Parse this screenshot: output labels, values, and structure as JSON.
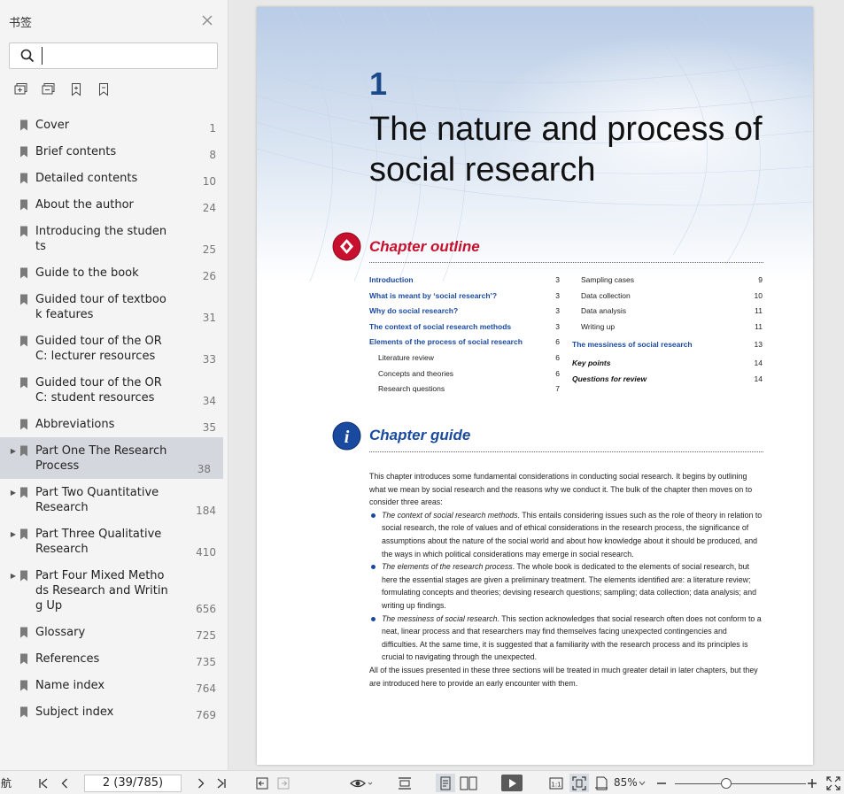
{
  "sidebar": {
    "title": "书签",
    "search_value": "",
    "bookmarks": [
      {
        "label": "Cover",
        "page": "1",
        "expandable": false
      },
      {
        "label": "Brief contents",
        "page": "8",
        "expandable": false
      },
      {
        "label": "Detailed contents",
        "page": "10",
        "expandable": false
      },
      {
        "label": "About the author",
        "page": "24",
        "expandable": false
      },
      {
        "label": "Introducing the students",
        "page": "25",
        "expandable": false
      },
      {
        "label": "Guide to the book",
        "page": "26",
        "expandable": false
      },
      {
        "label": "Guided tour of textbook features",
        "page": "31",
        "expandable": false
      },
      {
        "label": "Guided tour of the ORC: lecturer resources",
        "page": "33",
        "expandable": false
      },
      {
        "label": "Guided tour of the ORC: student resources",
        "page": "34",
        "expandable": false
      },
      {
        "label": "Abbreviations",
        "page": "35",
        "expandable": false
      },
      {
        "label": "Part One The Research Process",
        "page": "38",
        "expandable": true,
        "selected": true
      },
      {
        "label": "Part Two Quantitative Research",
        "page": "184",
        "expandable": true
      },
      {
        "label": "Part Three Qualitative Research",
        "page": "410",
        "expandable": true
      },
      {
        "label": "Part Four Mixed Methods Research and Writing Up",
        "page": "656",
        "expandable": true
      },
      {
        "label": "Glossary",
        "page": "725",
        "expandable": false
      },
      {
        "label": "References",
        "page": "735",
        "expandable": false
      },
      {
        "label": "Name index",
        "page": "764",
        "expandable": false
      },
      {
        "label": "Subject index",
        "page": "769",
        "expandable": false
      }
    ]
  },
  "document": {
    "chapter_number": "1",
    "chapter_title": "The nature and process of social research",
    "outline_heading": "Chapter outline",
    "outline_left": [
      {
        "text": "Introduction",
        "page": "3",
        "level": 1
      },
      {
        "text": "What is meant by ‘social research’?",
        "page": "3",
        "level": 1
      },
      {
        "text": "Why do social research?",
        "page": "3",
        "level": 1
      },
      {
        "text": "The context of social research methods",
        "page": "3",
        "level": 1
      },
      {
        "text": "Elements of the process of social research",
        "page": "6",
        "level": 1
      },
      {
        "text": "Literature review",
        "page": "6",
        "level": 2
      },
      {
        "text": "Concepts and theories",
        "page": "6",
        "level": 2
      },
      {
        "text": "Research questions",
        "page": "7",
        "level": 2
      }
    ],
    "outline_right": [
      {
        "text": "Sampling cases",
        "page": "9",
        "level": 2
      },
      {
        "text": "Data collection",
        "page": "10",
        "level": 2
      },
      {
        "text": "Data analysis",
        "page": "11",
        "level": 2
      },
      {
        "text": "Writing up",
        "page": "11",
        "level": 2
      },
      {
        "text": "The messiness of social research",
        "page": "13",
        "level": 1
      },
      {
        "text": "Key points",
        "page": "14",
        "level": 3
      },
      {
        "text": "Questions for review",
        "page": "14",
        "level": 3
      }
    ],
    "guide_heading": "Chapter guide",
    "guide_intro": "This chapter introduces some fundamental considerations in conducting social research. It begins by outlining what we mean by social research and the reasons why we conduct it. The bulk of the chapter then moves on to consider three areas:",
    "guide_bullets": [
      {
        "em": "The context of social research methods",
        "text": ". This entails considering issues such as the role of theory in relation to social research, the role of values and of ethical considerations in the research process, the significance of assumptions about the nature of the social world and about how knowledge about it should be produced, and the ways in which political considerations may emerge in social research."
      },
      {
        "em": "The elements of the research process",
        "text": ". The whole book is dedicated to the elements of social research, but here the essential stages are given a preliminary treatment. The elements identified are: a literature review; formulating concepts and theories; devising research questions; sampling; data collection; data analysis; and writing up findings."
      },
      {
        "em": "The messiness of social research",
        "text": ". This section acknowledges that social research often does not conform to a neat, linear process and that researchers may find themselves facing unexpected contingencies and difficulties. At the same time, it is suggested that a familiarity with the research process and its principles is crucial to navigating through the unexpected."
      }
    ],
    "guide_outro": "All of the issues presented in these three sections will be treated in much greater detail in later chapters, but they are introduced here to provide an early encounter with them."
  },
  "toolbar": {
    "nav_label": "航",
    "page_indicator": "2 (39/785)",
    "zoom_label": "85%",
    "zoom_level_percent": 85
  },
  "colors": {
    "accent_blue": "#1a4aa0",
    "accent_red": "#c8102e",
    "selected_bg": "#d4d8de"
  }
}
